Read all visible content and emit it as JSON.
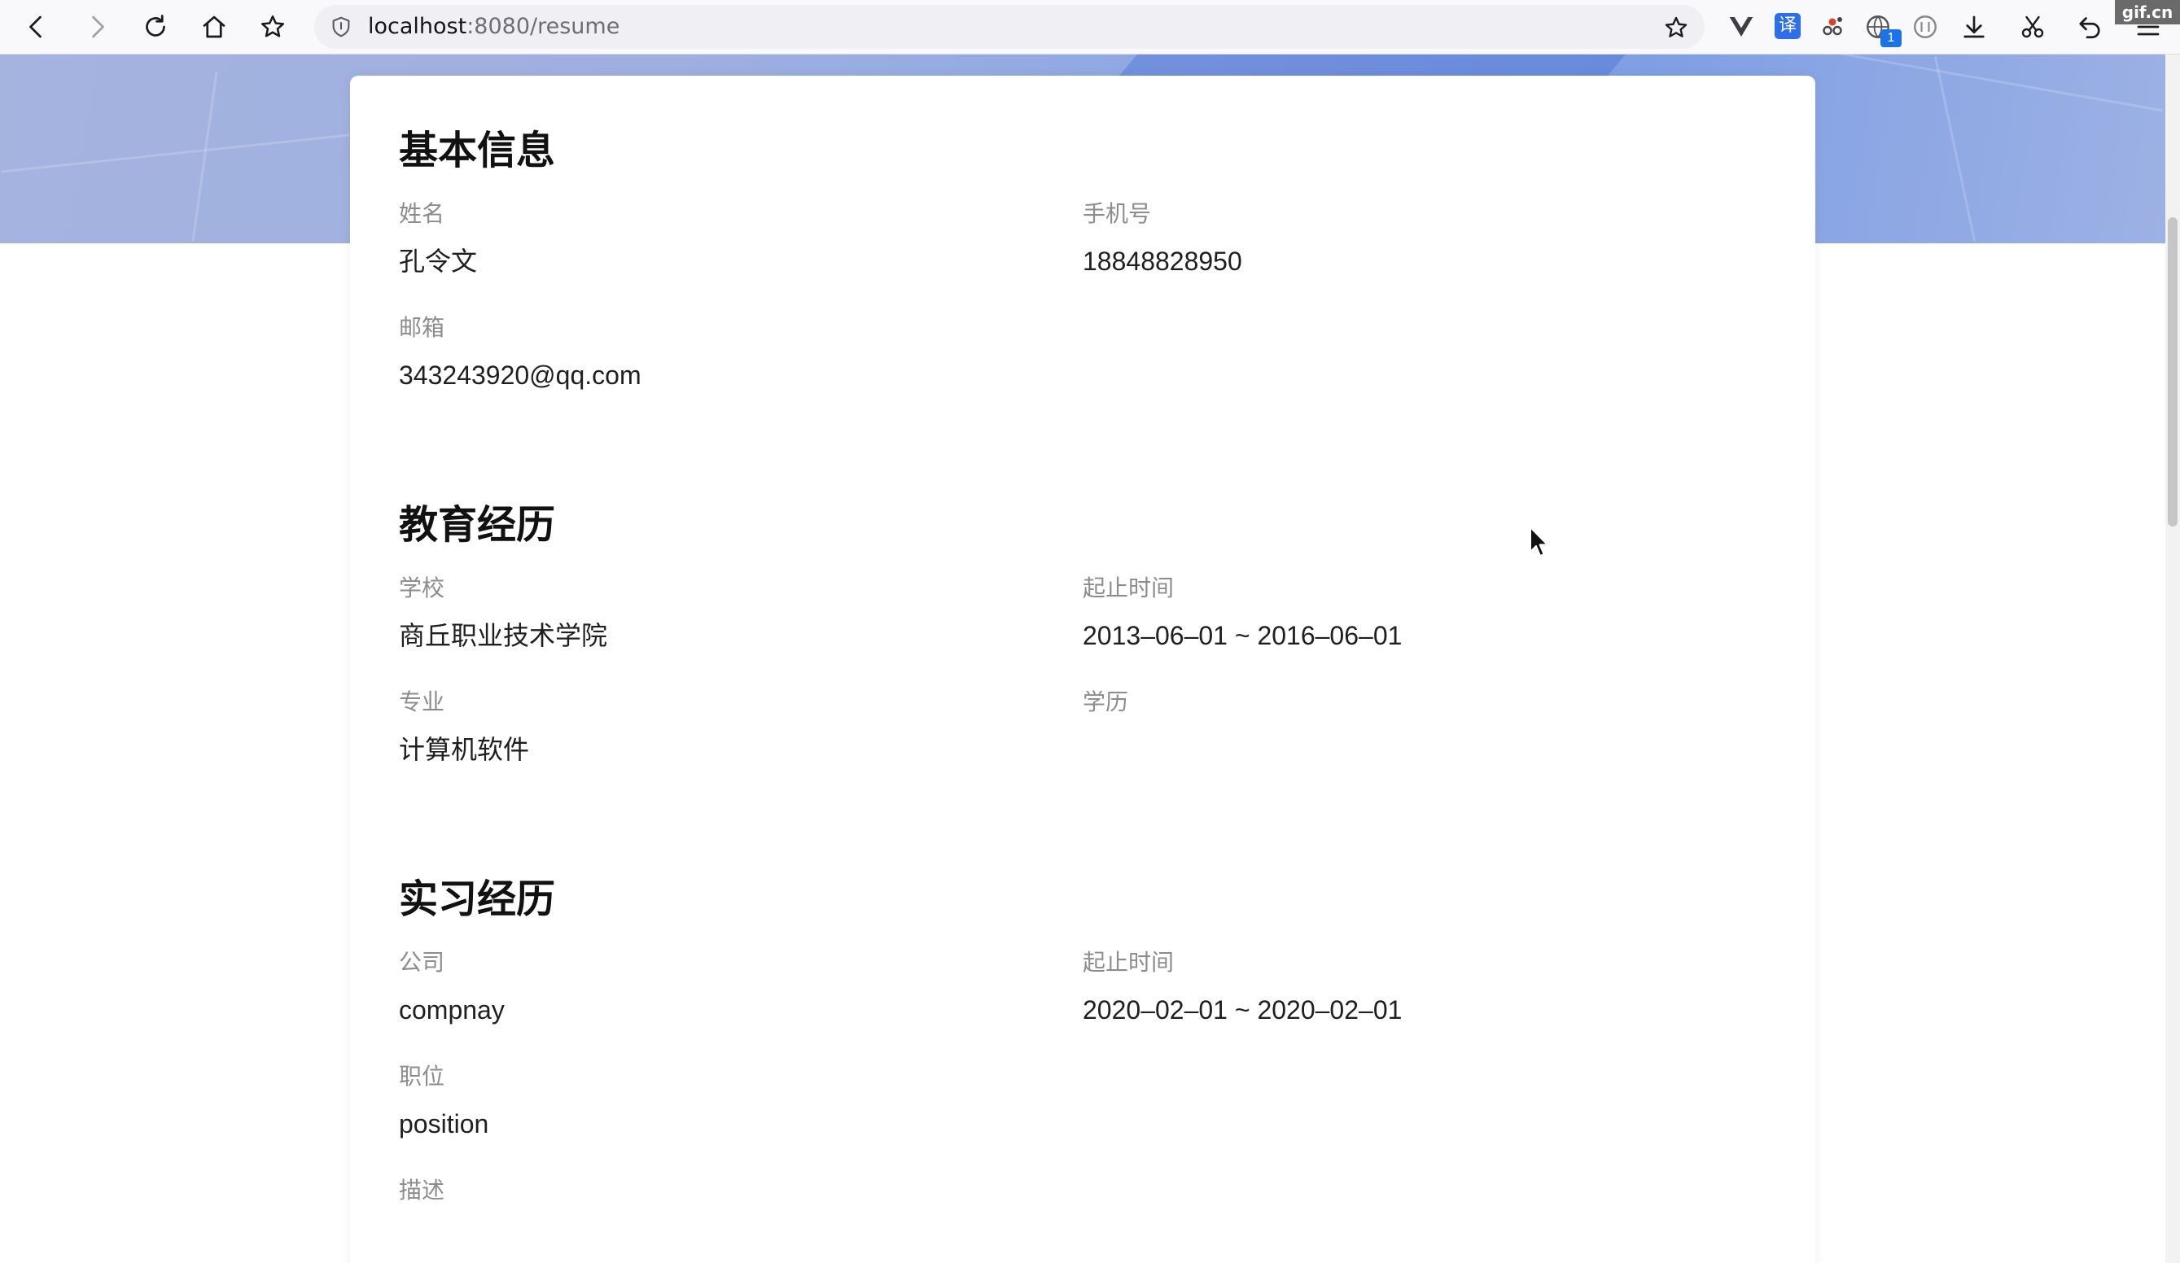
{
  "browser": {
    "url_host": "localhost",
    "url_rest": ":8080/resume",
    "translate_ext_label": "译",
    "ext_badge_count": "1",
    "watermark": "gif.cn",
    "icons": [
      "back-icon",
      "forward-icon",
      "reload-icon",
      "home-icon",
      "bookmark-star-icon",
      "shield-icon",
      "page-star-icon",
      "vue-devtools-icon",
      "translate-icon",
      "extension-icon",
      "vpn-icon",
      "reader-icon",
      "download-icon",
      "screenshot-icon",
      "undo-icon",
      "menu-icon"
    ]
  },
  "resume": {
    "basic": {
      "title": "基本信息",
      "name_label": "姓名",
      "name_value": "孔令文",
      "phone_label": "手机号",
      "phone_value": "18848828950",
      "email_label": "邮箱",
      "email_value": "343243920@qq.com"
    },
    "education": {
      "title": "教育经历",
      "school_label": "学校",
      "school_value": "商丘职业技术学院",
      "period_label": "起止时间",
      "period_value": "2013–06–01 ~ 2016–06–01",
      "major_label": "专业",
      "major_value": "计算机软件",
      "degree_label": "学历",
      "degree_value": ""
    },
    "internship": {
      "title": "实习经历",
      "company_label": "公司",
      "company_value": "compnay",
      "period_label": "起止时间",
      "period_value": "2020–02–01 ~ 2020–02–01",
      "position_label": "职位",
      "position_value": "position",
      "description_label": "描述"
    }
  },
  "colors": {
    "banner": "#8ea8e3",
    "label": "#8c8c8c",
    "value": "#1f1f1f",
    "title": "#111111",
    "accent_blue": "#2c6fe8"
  }
}
